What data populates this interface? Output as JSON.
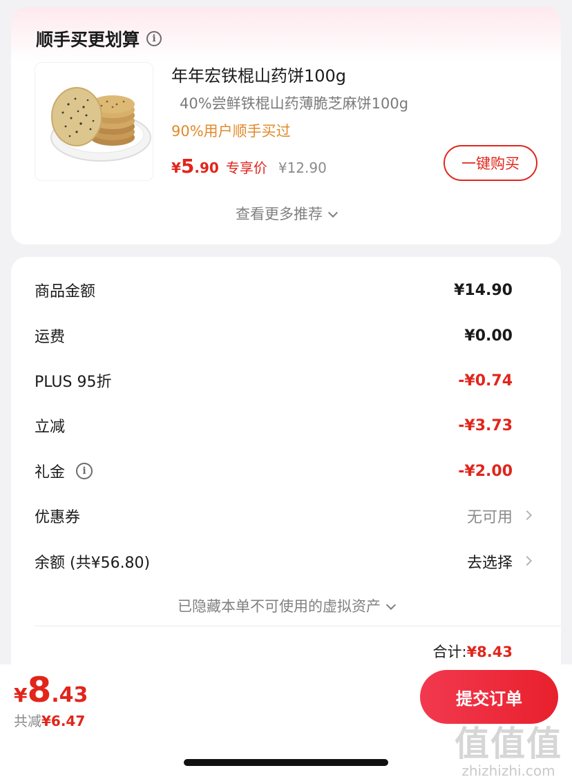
{
  "recommendation": {
    "title": "顺手买更划算",
    "product": {
      "name": "年年宏铁棍山药饼100g",
      "subtitle": "40%尝鲜铁棍山药薄脆芝麻饼100g",
      "social_proof": "90%用户顺手买过",
      "price_symbol": "¥",
      "price_int": "5",
      "price_dec": ".90",
      "price_tag": "专享价",
      "original_price": "¥12.90",
      "buy_label": "一键购买"
    },
    "more_label": "查看更多推荐"
  },
  "summary": {
    "rows": [
      {
        "label": "商品金额",
        "value": "¥14.90"
      },
      {
        "label": "运费",
        "value": "¥0.00"
      },
      {
        "label": "PLUS 95折",
        "value": "-¥0.74"
      },
      {
        "label": "立减",
        "value": "-¥3.73"
      },
      {
        "label": "礼金",
        "value": "-¥2.00"
      },
      {
        "label": "优惠券",
        "value": "无可用"
      },
      {
        "label": "余额 (共¥56.80)",
        "value": "去选择"
      }
    ],
    "hidden_assets_label": "已隐藏本单不可使用的虚拟资产",
    "subtotal_label": "合计:",
    "subtotal_value": "¥8.43"
  },
  "footer": {
    "price_symbol": "¥",
    "price_int": "8",
    "price_dec": ".43",
    "saved_label": "共减",
    "saved_value": "¥6.47",
    "submit_label": "提交订单"
  },
  "watermark": {
    "logo_text": "值值值",
    "url": "zhizhizhi.com"
  },
  "colors": {
    "accent_red": "#e1251b",
    "social_orange": "#e08a2c"
  }
}
